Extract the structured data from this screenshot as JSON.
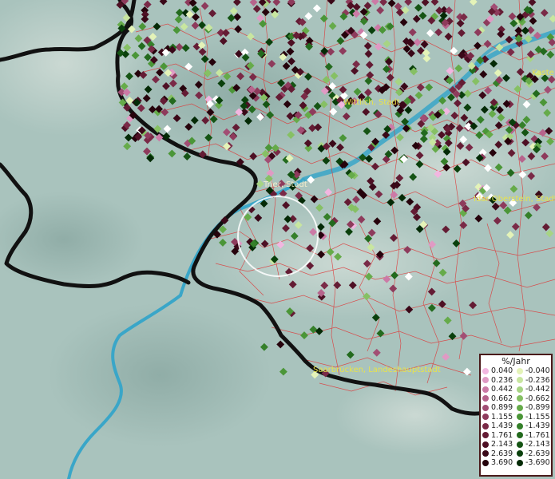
{
  "map": {
    "places": [
      {
        "name": "Wittlich, Stadt"
      },
      {
        "name": "Trier, Stadt"
      },
      {
        "name": "Idar-Oberstein, Stadt"
      },
      {
        "name": "Saarbrücken, Landeshauptstadt"
      },
      {
        "name": "Kaste"
      }
    ]
  },
  "legend": {
    "title": "%/Jahr",
    "positive": [
      {
        "value": "0.040",
        "color": "#f2b6e0"
      },
      {
        "value": "0.236",
        "color": "#e09ac4"
      },
      {
        "value": "0.442",
        "color": "#cc7aa6"
      },
      {
        "value": "0.662",
        "color": "#b7648c"
      },
      {
        "value": "0.899",
        "color": "#a24e74"
      },
      {
        "value": "1.155",
        "color": "#8e3b5c"
      },
      {
        "value": "1.439",
        "color": "#7a2a47"
      },
      {
        "value": "1.761",
        "color": "#641c34"
      },
      {
        "value": "2.143",
        "color": "#4e1024"
      },
      {
        "value": "2.639",
        "color": "#3a0818"
      },
      {
        "value": "3.690",
        "color": "#26030c"
      }
    ],
    "negative": [
      {
        "value": "-0.040",
        "color": "#e4f3b8"
      },
      {
        "value": "-0.236",
        "color": "#c8e6a0"
      },
      {
        "value": "-0.442",
        "color": "#a7d484"
      },
      {
        "value": "-0.662",
        "color": "#86c064"
      },
      {
        "value": "-0.899",
        "color": "#66ab4a"
      },
      {
        "value": "-1.155",
        "color": "#4b9638"
      },
      {
        "value": "-1.439",
        "color": "#35802a"
      },
      {
        "value": "-1.761",
        "color": "#236a1e"
      },
      {
        "value": "-2.143",
        "color": "#155414"
      },
      {
        "value": "-2.639",
        "color": "#0a400c"
      },
      {
        "value": "-3.690",
        "color": "#042a06"
      }
    ]
  },
  "colors": {
    "terrain": "#a9c3bd",
    "river": "#3aa6c8",
    "border": "#111111",
    "municipal_lines": "#dd3a3a",
    "label": "#e9e34a"
  }
}
